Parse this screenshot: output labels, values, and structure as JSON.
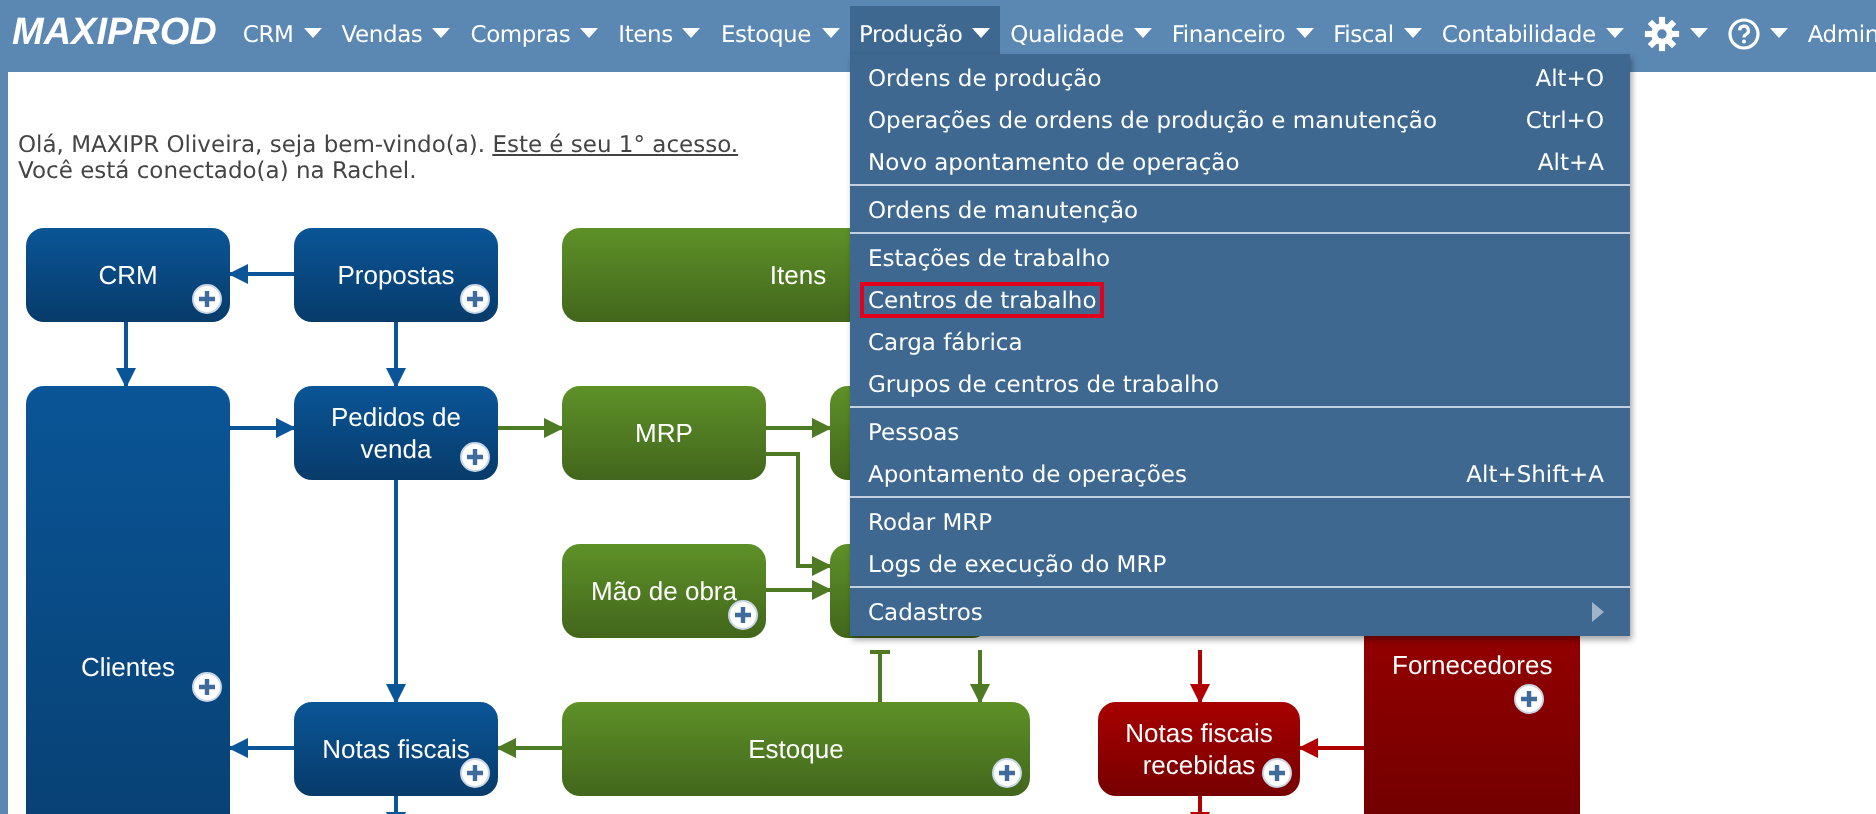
{
  "nav": {
    "logo": "MAXIPROD",
    "items": [
      {
        "kind": "text",
        "label": "CRM",
        "selected": false
      },
      {
        "kind": "text",
        "label": "Vendas",
        "selected": false
      },
      {
        "kind": "text",
        "label": "Compras",
        "selected": false
      },
      {
        "kind": "text",
        "label": "Itens",
        "selected": false
      },
      {
        "kind": "text",
        "label": "Estoque",
        "selected": false
      },
      {
        "kind": "text",
        "label": "Produção",
        "selected": true
      },
      {
        "kind": "text",
        "label": "Qualidade",
        "selected": false
      },
      {
        "kind": "text",
        "label": "Financeiro",
        "selected": false
      },
      {
        "kind": "text",
        "label": "Fiscal",
        "selected": false
      },
      {
        "kind": "text",
        "label": "Contabilidade",
        "selected": false
      },
      {
        "kind": "settings",
        "selected": false
      },
      {
        "kind": "help",
        "selected": false
      },
      {
        "kind": "user",
        "label": "Admin",
        "selected": false
      }
    ]
  },
  "welcome": {
    "greeting": "Olá, MAXIPR Oliveira, seja bem-vindo(a).",
    "link": "Este é seu 1° acesso.",
    "connected": "Você está conectado(a) na Rachel."
  },
  "menu": {
    "groups": [
      [
        {
          "label": "Ordens de produção",
          "shortcut": "Alt+O",
          "highlighted": false
        },
        {
          "label": "Operações de ordens de produção e manutenção",
          "shortcut": "Ctrl+O",
          "highlighted": false
        },
        {
          "label": "Novo apontamento de operação",
          "shortcut": "Alt+A",
          "highlighted": false
        }
      ],
      [
        {
          "label": "Ordens de manutenção",
          "highlighted": false
        }
      ],
      [
        {
          "label": "Estações de trabalho",
          "highlighted": false
        },
        {
          "label": "Centros de trabalho",
          "highlighted": true
        },
        {
          "label": "Carga fábrica",
          "highlighted": false
        },
        {
          "label": "Grupos de centros de trabalho",
          "highlighted": false
        }
      ],
      [
        {
          "label": "Pessoas",
          "highlighted": false
        },
        {
          "label": "Apontamento de operações",
          "shortcut": "Alt+Shift+A",
          "highlighted": false
        }
      ],
      [
        {
          "label": "Rodar MRP",
          "highlighted": false
        },
        {
          "label": "Logs de execução do MRP",
          "highlighted": false
        }
      ],
      [
        {
          "label": "Cadastros",
          "submenu": true,
          "highlighted": false
        }
      ]
    ]
  },
  "diagram": {
    "nodes": [
      {
        "label": "CRM",
        "color": "#0a5597",
        "add": true
      },
      {
        "label": "Propostas",
        "color": "#0a5597",
        "add": true
      },
      {
        "label": "Itens",
        "color": "#5e9128",
        "add": false
      },
      {
        "label": "Clientes",
        "color": "#0a5597",
        "add": true
      },
      {
        "label": "Pedidos de venda",
        "color": "#0a5597",
        "add": true
      },
      {
        "label": "MRP",
        "color": "#5e9128",
        "add": false
      },
      {
        "color": "#5e9128",
        "add": false
      },
      {
        "label": "Mão de obra",
        "color": "#5e9128",
        "add": true
      },
      {
        "color": "#5e9128",
        "add": false
      },
      {
        "label": "Notas fiscais",
        "color": "#0a5597",
        "add": true
      },
      {
        "label": "Estoque",
        "color": "#5e9128",
        "add": true
      },
      {
        "label": "Notas fiscais recebidas",
        "color": "#a80000",
        "add": true
      },
      {
        "label": "Fornecedores",
        "color": "#990000",
        "add": true
      }
    ]
  }
}
